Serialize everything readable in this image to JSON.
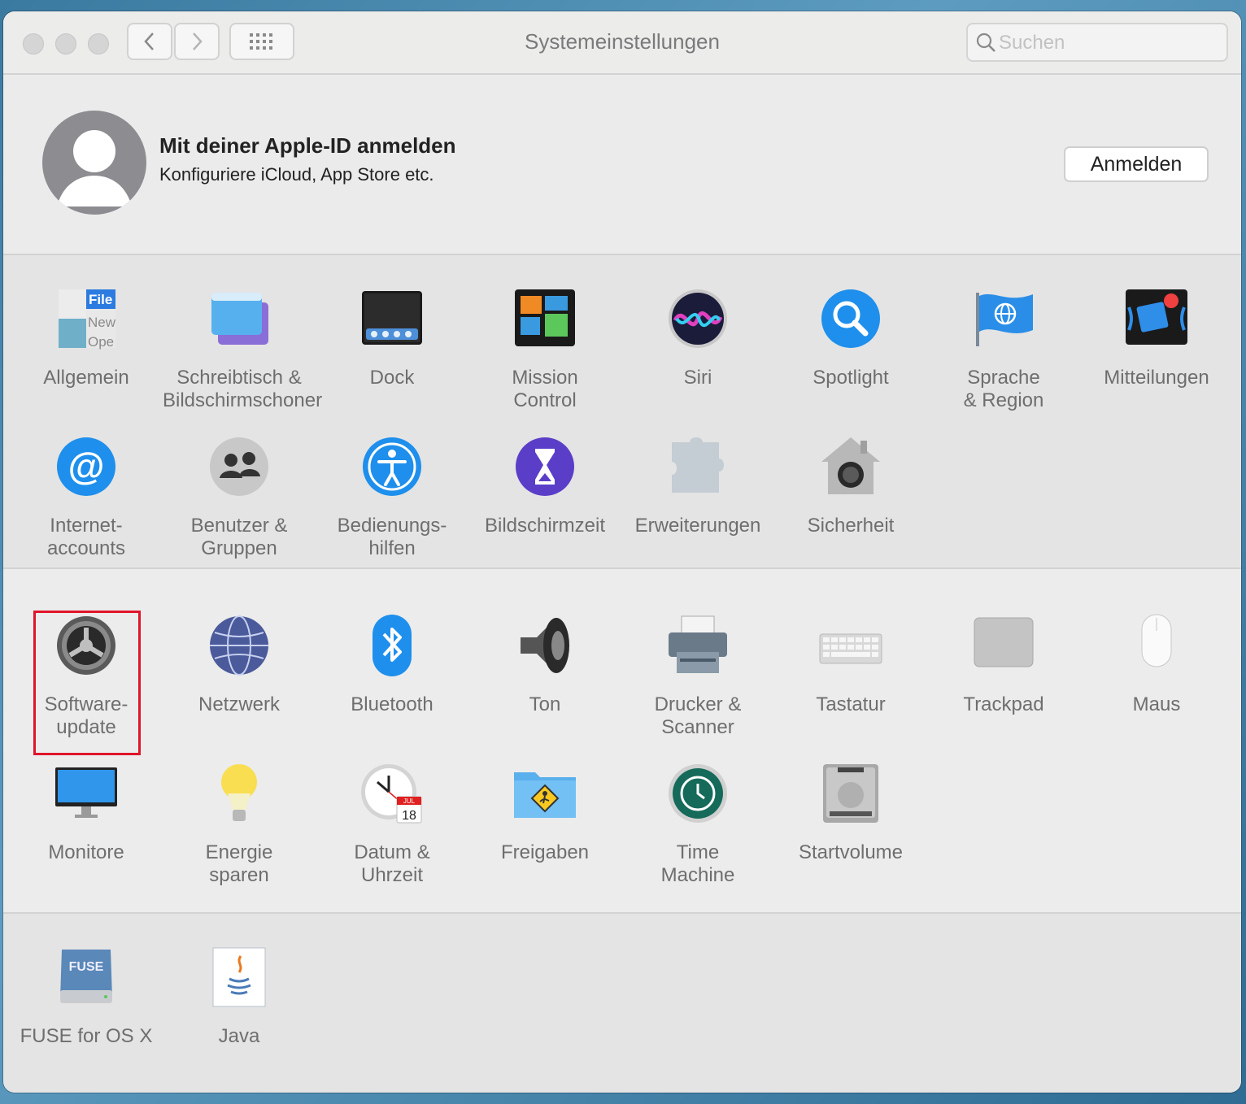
{
  "window": {
    "title": "Systemeinstellungen"
  },
  "search": {
    "placeholder": "Suchen"
  },
  "account": {
    "title": "Mit deiner Apple-ID anmelden",
    "subtitle": "Konfiguriere iCloud, App Store etc.",
    "login_label": "Anmelden"
  },
  "section1": [
    {
      "label": "Allgemein",
      "icon": "general-icon"
    },
    {
      "label": "Schreibtisch &\nBildschirmschoner",
      "icon": "desktop-screensaver-icon"
    },
    {
      "label": "Dock",
      "icon": "dock-icon"
    },
    {
      "label": "Mission\nControl",
      "icon": "mission-control-icon"
    },
    {
      "label": "Siri",
      "icon": "siri-icon"
    },
    {
      "label": "Spotlight",
      "icon": "spotlight-icon"
    },
    {
      "label": "Sprache\n& Region",
      "icon": "language-region-icon"
    },
    {
      "label": "Mitteilungen",
      "icon": "notifications-icon"
    },
    {
      "label": "Internet-\naccounts",
      "icon": "internet-accounts-icon"
    },
    {
      "label": "Benutzer &\nGruppen",
      "icon": "users-groups-icon"
    },
    {
      "label": "Bedienungs-\nhilfen",
      "icon": "accessibility-icon"
    },
    {
      "label": "Bildschirmzeit",
      "icon": "screen-time-icon"
    },
    {
      "label": "Erweiterungen",
      "icon": "extensions-icon"
    },
    {
      "label": "Sicherheit",
      "icon": "security-icon"
    }
  ],
  "section2": [
    {
      "label": "Software-\nupdate",
      "icon": "software-update-icon"
    },
    {
      "label": "Netzwerk",
      "icon": "network-icon"
    },
    {
      "label": "Bluetooth",
      "icon": "bluetooth-icon"
    },
    {
      "label": "Ton",
      "icon": "sound-icon"
    },
    {
      "label": "Drucker &\nScanner",
      "icon": "printer-scanner-icon"
    },
    {
      "label": "Tastatur",
      "icon": "keyboard-icon"
    },
    {
      "label": "Trackpad",
      "icon": "trackpad-icon"
    },
    {
      "label": "Maus",
      "icon": "mouse-icon"
    },
    {
      "label": "Monitore",
      "icon": "displays-icon"
    },
    {
      "label": "Energie\nsparen",
      "icon": "energy-saver-icon"
    },
    {
      "label": "Datum &\nUhrzeit",
      "icon": "date-time-icon"
    },
    {
      "label": "Freigaben",
      "icon": "sharing-icon"
    },
    {
      "label": "Time\nMachine",
      "icon": "time-machine-icon"
    },
    {
      "label": "Startvolume",
      "icon": "startup-disk-icon"
    }
  ],
  "section3": [
    {
      "label": "FUSE for OS X",
      "icon": "fuse-icon"
    },
    {
      "label": "Java",
      "icon": "java-icon"
    }
  ],
  "icon_text": {
    "general": [
      "File",
      "New",
      "Ope"
    ],
    "calendar_month": "JUL",
    "calendar_day": "18",
    "fuse": "FUSE"
  },
  "colors": {
    "highlight": "#e0142a",
    "accent_blue": "#1e88e5",
    "background": "#ececec"
  }
}
